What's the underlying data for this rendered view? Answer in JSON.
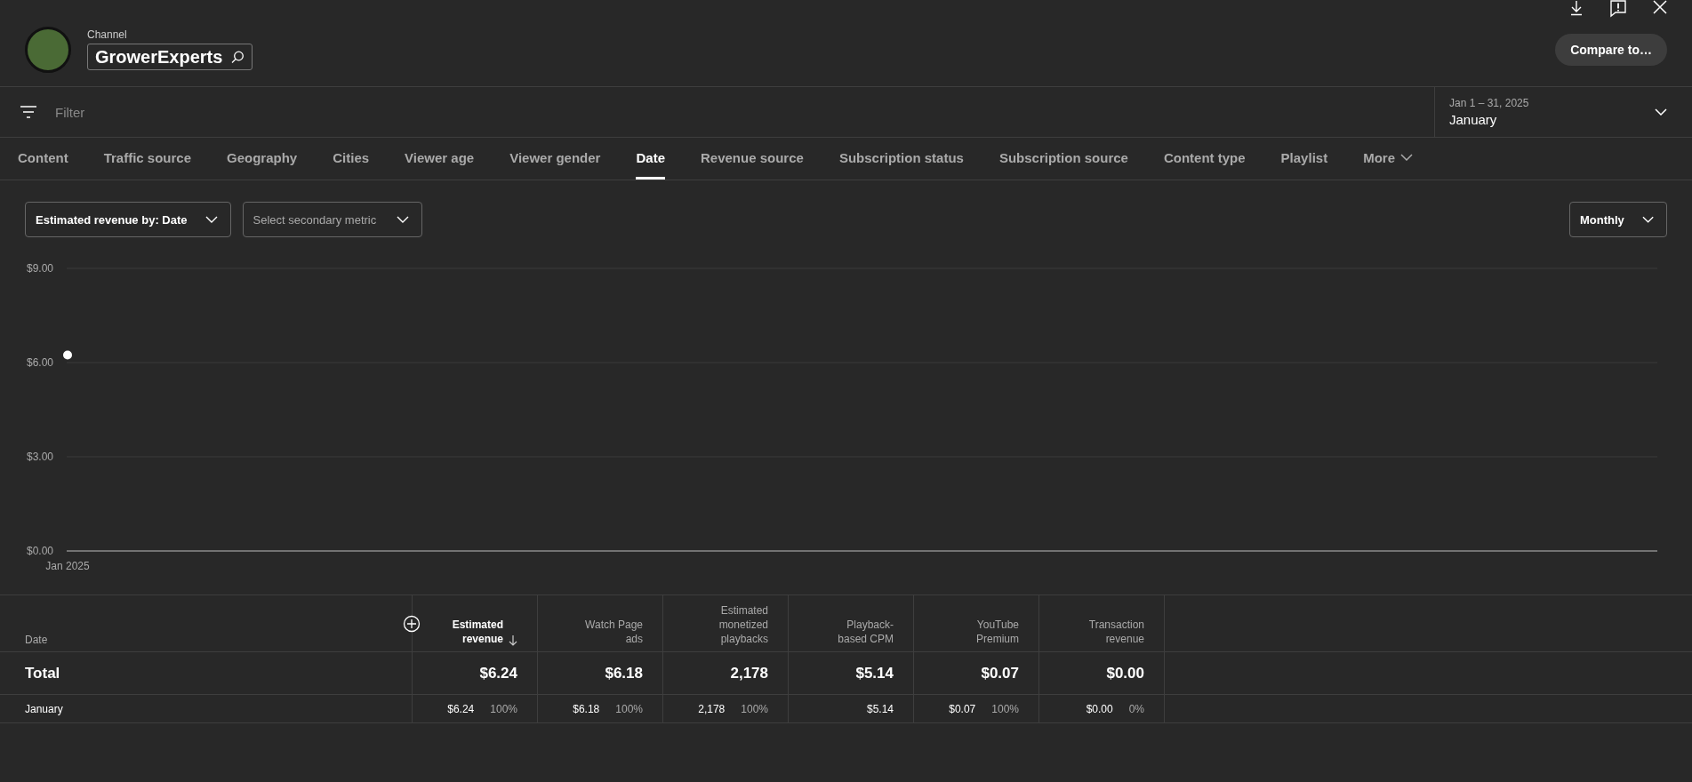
{
  "header": {
    "channel_label": "Channel",
    "channel_name": "GrowerExperts",
    "compare_button": "Compare to…"
  },
  "filter": {
    "placeholder": "Filter"
  },
  "date_range": {
    "range": "Jan 1 – 31, 2025",
    "label": "January"
  },
  "tabs": [
    {
      "label": "Content",
      "selected": false
    },
    {
      "label": "Traffic source",
      "selected": false
    },
    {
      "label": "Geography",
      "selected": false
    },
    {
      "label": "Cities",
      "selected": false
    },
    {
      "label": "Viewer age",
      "selected": false
    },
    {
      "label": "Viewer gender",
      "selected": false
    },
    {
      "label": "Date",
      "selected": true
    },
    {
      "label": "Revenue source",
      "selected": false
    },
    {
      "label": "Subscription status",
      "selected": false
    },
    {
      "label": "Subscription source",
      "selected": false
    },
    {
      "label": "Content type",
      "selected": false
    },
    {
      "label": "Playlist",
      "selected": false
    }
  ],
  "more_tab": "More",
  "controls": {
    "primary_metric": "Estimated revenue by: Date",
    "secondary_metric": {
      "placeholder": "Select secondary metric"
    },
    "interval": "Monthly"
  },
  "chart_data": {
    "type": "scatter",
    "grid": true,
    "categories": [
      "Jan 2025"
    ],
    "series": [
      {
        "color": "#ffffff",
        "values": [
          6.24
        ]
      }
    ],
    "ylim": [
      0,
      9
    ],
    "yticks": [
      {
        "value": 0,
        "label": "$0.00"
      },
      {
        "value": 3,
        "label": "$3.00"
      },
      {
        "value": 6,
        "label": "$6.00"
      },
      {
        "value": 9,
        "label": "$9.00"
      }
    ]
  },
  "table": {
    "columns": [
      {
        "label": "Date",
        "sorted": false
      },
      {
        "label": "Estimated revenue",
        "sorted": true
      },
      {
        "label": "Watch Page ads",
        "sorted": false
      },
      {
        "label": "Estimated monetized playbacks",
        "sorted": false
      },
      {
        "label": "Playback-based CPM",
        "sorted": false
      },
      {
        "label": "YouTube Premium",
        "sorted": false
      },
      {
        "label": "Transaction revenue",
        "sorted": false
      }
    ],
    "rows": [
      {
        "kind": "total",
        "cells": [
          {
            "value": "Total"
          },
          {
            "value": "$6.24"
          },
          {
            "value": "$6.18"
          },
          {
            "value": "2,178"
          },
          {
            "value": "$5.14"
          },
          {
            "value": "$0.07"
          },
          {
            "value": "$0.00"
          }
        ]
      },
      {
        "kind": "data",
        "cells": [
          {
            "value": "January"
          },
          {
            "value": "$6.24",
            "share": "100%"
          },
          {
            "value": "$6.18",
            "share": "100%"
          },
          {
            "value": "2,178",
            "share": "100%"
          },
          {
            "value": "$5.14"
          },
          {
            "value": "$0.07",
            "share": "100%"
          },
          {
            "value": "$0.00",
            "share": "0%"
          }
        ]
      }
    ]
  }
}
